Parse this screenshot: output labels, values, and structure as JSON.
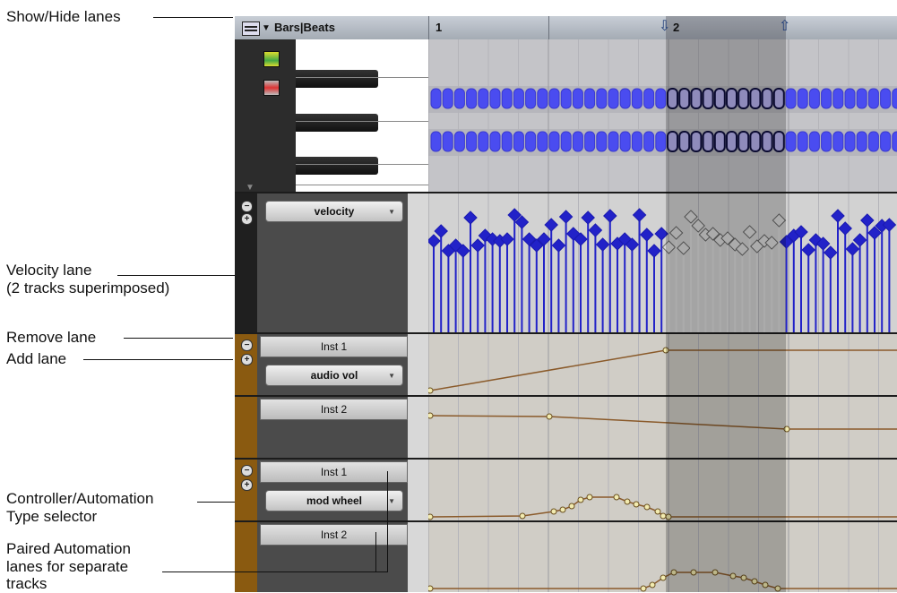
{
  "callouts": {
    "show_hide": "Show/Hide lanes",
    "velocity_l1": "Velocity lane",
    "velocity_l2": "(2 tracks superimposed)",
    "remove_lane": "Remove lane",
    "add_lane": "Add lane",
    "ctrl_l1": "Controller/Automation",
    "ctrl_l2": "Type selector",
    "paired_l1": "Paired Automation",
    "paired_l2": "lanes for separate",
    "paired_l3": "tracks"
  },
  "toolbar": {
    "ruler_label": "Bars|Beats",
    "bar_1": "1",
    "bar_2": "2"
  },
  "lanes": {
    "velocity_selector": "velocity",
    "audio_track": "Inst 1",
    "audio_selector": "audio vol",
    "inst2_a": "Inst 2",
    "mod_track": "Inst 1",
    "mod_selector": "mod wheel",
    "inst2_b": "Inst 2"
  },
  "colors": {
    "note_fill": "#4a4cf0",
    "note_selected": "#b8b2f0",
    "velocity": "#2222c8",
    "velocity_selected": "#dcdcdc",
    "automation_line": "#8a5a2a",
    "automation_point": "#f2ebb0",
    "automation_gutter": "#8a5a10",
    "selection": "#000000"
  },
  "icons": {
    "show_hide": "show-hide-lanes-icon",
    "remove": "minus-circle-icon",
    "add": "plus-circle-icon"
  }
}
